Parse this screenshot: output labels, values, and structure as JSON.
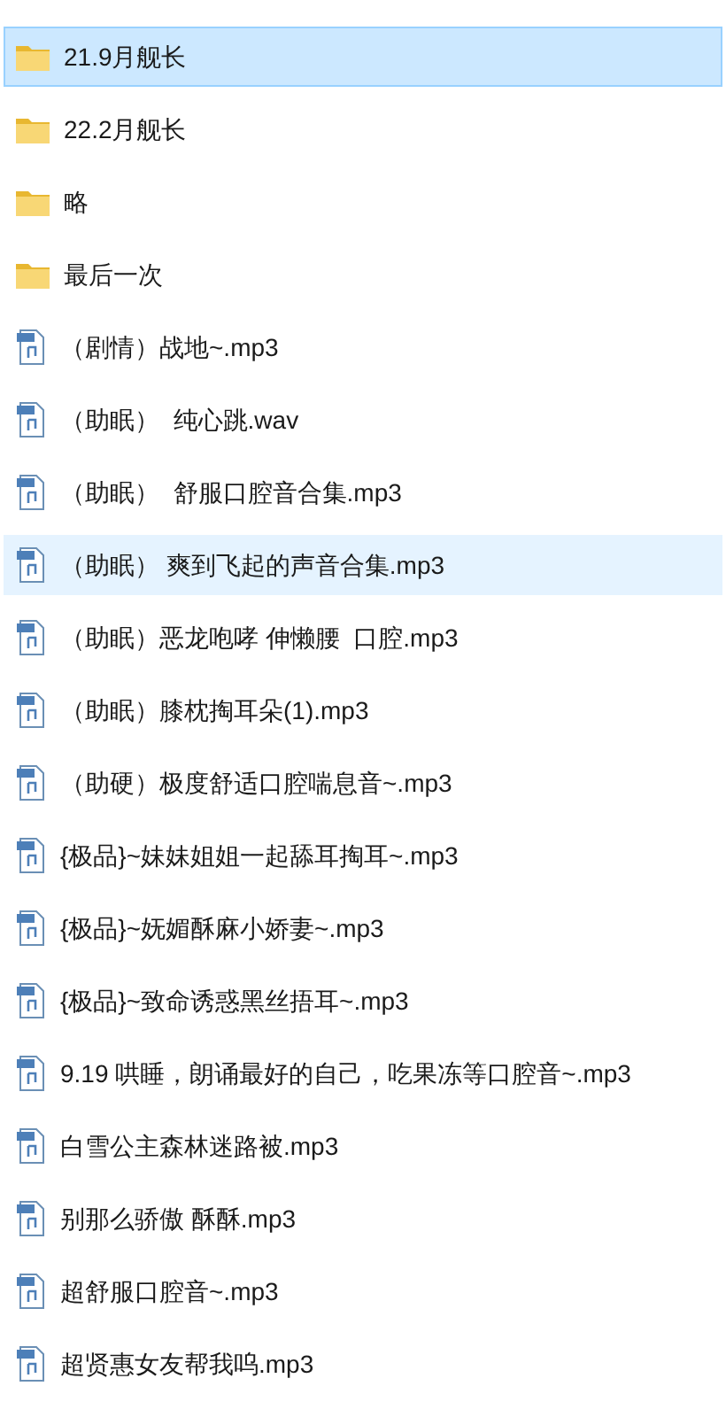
{
  "files": [
    {
      "kind": "folder",
      "name": "21.9月舰长",
      "selected": true,
      "hovered": false
    },
    {
      "kind": "folder",
      "name": "22.2月舰长",
      "selected": false,
      "hovered": false
    },
    {
      "kind": "folder",
      "name": "略",
      "selected": false,
      "hovered": false
    },
    {
      "kind": "folder",
      "name": "最后一次",
      "selected": false,
      "hovered": false
    },
    {
      "kind": "audio",
      "name": "（剧情）战地~.mp3",
      "selected": false,
      "hovered": false
    },
    {
      "kind": "audio",
      "name": "（助眠）  纯心跳.wav",
      "selected": false,
      "hovered": false
    },
    {
      "kind": "audio",
      "name": "（助眠）  舒服口腔音合集.mp3",
      "selected": false,
      "hovered": false
    },
    {
      "kind": "audio",
      "name": "（助眠） 爽到飞起的声音合集.mp3",
      "selected": false,
      "hovered": true
    },
    {
      "kind": "audio",
      "name": "（助眠）恶龙咆哮 伸懒腰  口腔.mp3",
      "selected": false,
      "hovered": false
    },
    {
      "kind": "audio",
      "name": "（助眠）膝枕掏耳朵(1).mp3",
      "selected": false,
      "hovered": false
    },
    {
      "kind": "audio",
      "name": "（助硬）极度舒适口腔喘息音~.mp3",
      "selected": false,
      "hovered": false
    },
    {
      "kind": "audio",
      "name": "{极品}~妹妹姐姐一起舔耳掏耳~.mp3",
      "selected": false,
      "hovered": false
    },
    {
      "kind": "audio",
      "name": "{极品}~妩媚酥麻小娇妻~.mp3",
      "selected": false,
      "hovered": false
    },
    {
      "kind": "audio",
      "name": "{极品}~致命诱惑黑丝捂耳~.mp3",
      "selected": false,
      "hovered": false
    },
    {
      "kind": "audio",
      "name": "9.19 哄睡，朗诵最好的自己，吃果冻等口腔音~.mp3",
      "selected": false,
      "hovered": false
    },
    {
      "kind": "audio",
      "name": "白雪公主森林迷路被.mp3",
      "selected": false,
      "hovered": false
    },
    {
      "kind": "audio",
      "name": "别那么骄傲 酥酥.mp3",
      "selected": false,
      "hovered": false
    },
    {
      "kind": "audio",
      "name": "超舒服口腔音~.mp3",
      "selected": false,
      "hovered": false
    },
    {
      "kind": "audio",
      "name": "超贤惠女友帮我呜.mp3",
      "selected": false,
      "hovered": false
    }
  ]
}
